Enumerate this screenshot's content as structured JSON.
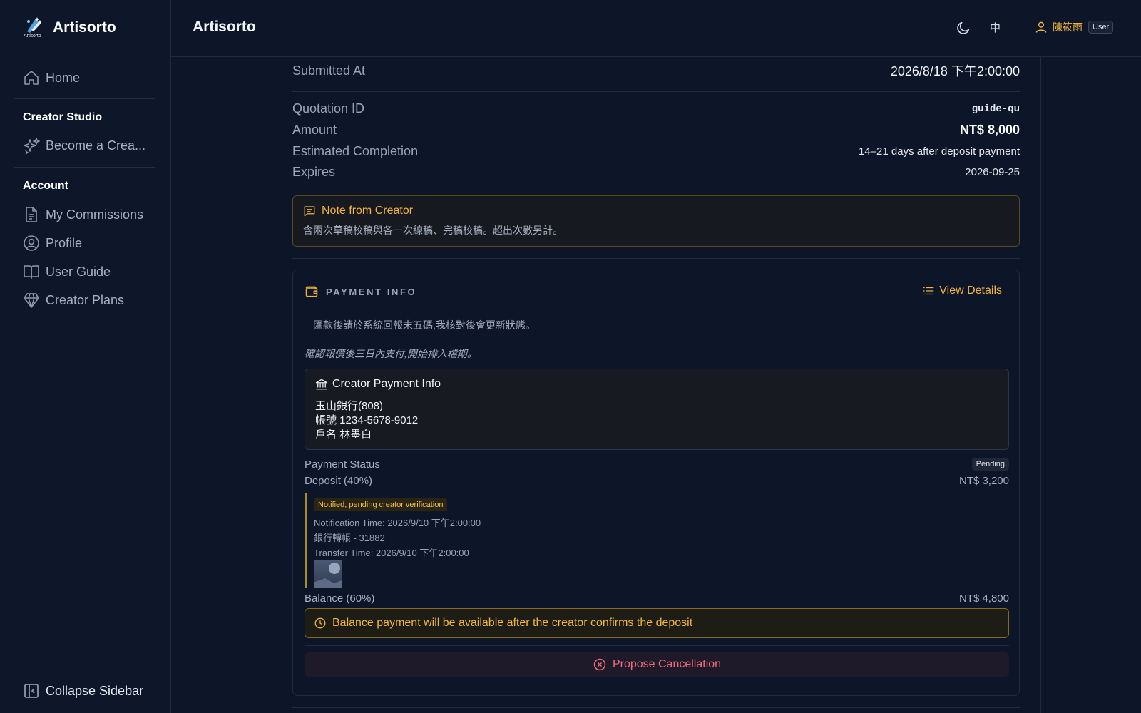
{
  "app": {
    "brand_name": "Artisorto",
    "brand_logo_text": "Artisorto",
    "accent_color": "#f2b53a",
    "danger_color": "#f06a7a"
  },
  "sidebar": {
    "home": "Home",
    "creator_studio_heading": "Creator Studio",
    "become_creator": "Become a Crea...",
    "account_heading": "Account",
    "my_commissions": "My Commissions",
    "profile": "Profile",
    "user_guide": "User Guide",
    "creator_plans": "Creator Plans",
    "collapse": "Collapse Sidebar"
  },
  "header": {
    "title": "Artisorto",
    "language": "中",
    "user_name": "陳筱雨",
    "user_role": "User"
  },
  "quotation": {
    "submitted_label": "Submitted At",
    "submitted_value": "2026/8/18 下午2:00:00",
    "id_label": "Quotation ID",
    "id_value": "guide-qu",
    "amount_label": "Amount",
    "amount_value": "NT$ 8,000",
    "completion_label": "Estimated Completion",
    "completion_value": "14–21 days after deposit payment",
    "expires_label": "Expires",
    "expires_value": "2026-09-25"
  },
  "note": {
    "title": "Note from Creator",
    "text": "含兩次草稿校稿與各一次線稿、完稿校稿。超出次數另計。"
  },
  "payment": {
    "heading": "PAYMENT INFO",
    "view_details": "View Details",
    "note1": "匯款後請於系統回報末五碼,我核對後會更新狀態。",
    "note2": "確認報價後三日內支付,開始排入檔期。",
    "bank_title": "Creator Payment Info",
    "bank_lines": [
      "玉山銀行(808)",
      "帳號 1234-5678-9012",
      "戶名 林墨白"
    ],
    "status_label": "Payment Status",
    "status_value": "Pending",
    "deposit_label": "Deposit (40%)",
    "deposit_value": "NT$ 3,200",
    "deposit_badge": "Notified, pending creator verification",
    "notification_time": "Notification Time: 2026/9/10 下午2:00:00",
    "transfer_method": "銀行轉帳 - 31882",
    "transfer_time": "Transfer Time: 2026/9/10 下午2:00:00",
    "balance_label": "Balance (60%)",
    "balance_value": "NT$ 4,800",
    "balance_note": "Balance payment will be available after the creator confirms the deposit",
    "cancel_label": "Propose Cancellation"
  }
}
